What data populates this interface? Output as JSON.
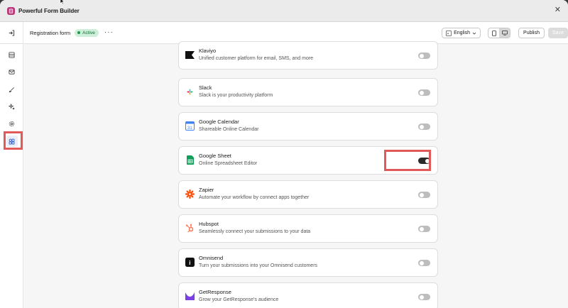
{
  "window": {
    "title": "Powerful Form Builder",
    "close_glyph": "✕"
  },
  "toolbar": {
    "form_name": "Registration form",
    "status": "Active",
    "more_glyph": "···",
    "language": "English",
    "publish_label": "Publish",
    "save_label": "Save"
  },
  "sidebar": {
    "items": [
      {
        "icon": "exit-icon"
      },
      {
        "icon": "layout-icon"
      },
      {
        "icon": "mail-icon"
      },
      {
        "icon": "brush-icon"
      },
      {
        "icon": "sparkle-icon"
      },
      {
        "icon": "gear-icon"
      },
      {
        "icon": "integrations-icon",
        "active": true
      }
    ]
  },
  "integrations": [
    {
      "name": "Klaviyo",
      "desc": "Unified customer platform for email, SMS, and more",
      "enabled": false,
      "icon": "klaviyo-icon"
    },
    {
      "name": "Slack",
      "desc": "Slack is your productivity platform",
      "enabled": false,
      "icon": "slack-icon"
    },
    {
      "name": "Google Calendar",
      "desc": "Shareable Online Calendar",
      "enabled": false,
      "icon": "google-calendar-icon",
      "icon_text": "31"
    },
    {
      "name": "Google Sheet",
      "desc": "Online Spreadsheet Editor",
      "enabled": true,
      "icon": "google-sheet-icon"
    },
    {
      "name": "Zapier",
      "desc": "Automate your workflow by connect apps together",
      "enabled": false,
      "icon": "zapier-icon"
    },
    {
      "name": "Hubspot",
      "desc": "Seamlessly connect your submissions to your data",
      "enabled": false,
      "icon": "hubspot-icon"
    },
    {
      "name": "Omnisend",
      "desc": "Turn your submissions into your Omnisend customers",
      "enabled": false,
      "icon": "omnisend-icon",
      "icon_text": "i"
    },
    {
      "name": "GetResponse",
      "desc": "Grow your GetResponse's audience",
      "enabled": false,
      "icon": "getresponse-icon"
    }
  ],
  "colors": {
    "highlight": "#e05a5a",
    "active_badge_bg": "#cdeed8",
    "toggle_on": "#2b2b2b",
    "toggle_off": "#bdbdbd"
  }
}
